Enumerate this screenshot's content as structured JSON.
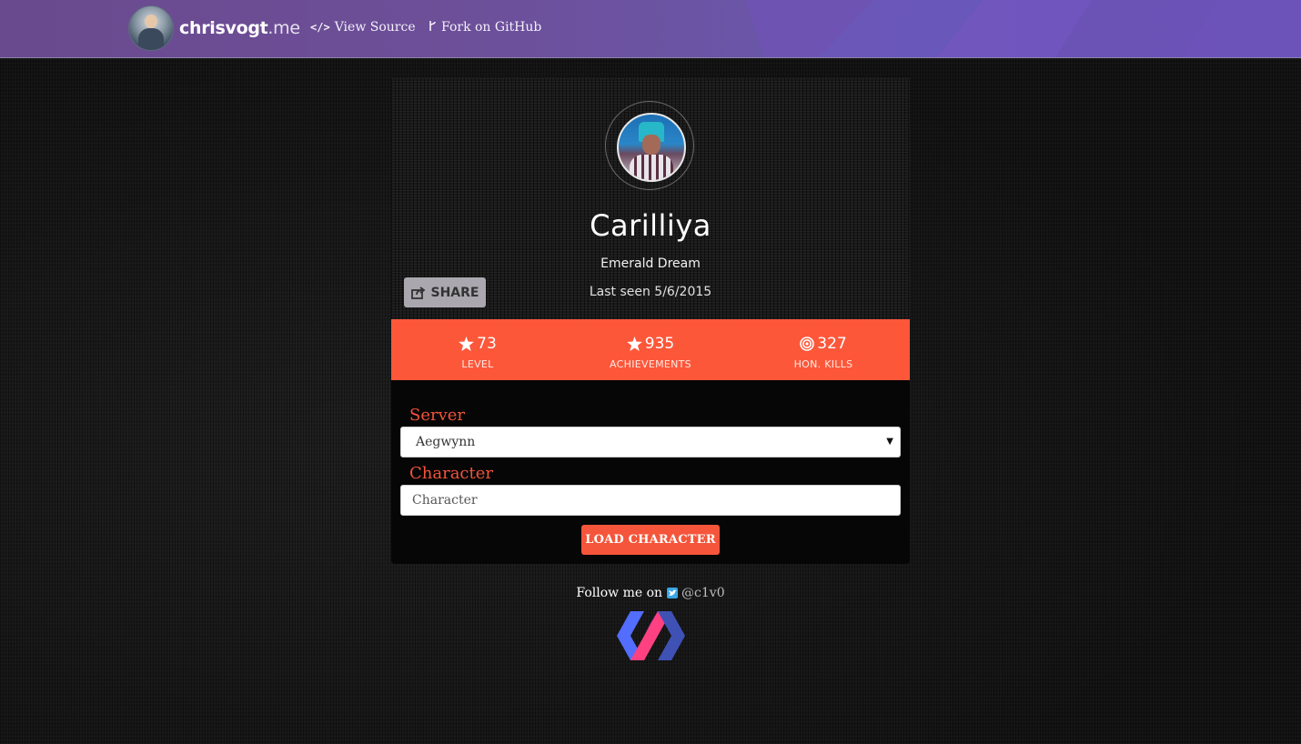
{
  "nav": {
    "brand_name": "chrisvogt",
    "brand_tld": ".me",
    "view_source_icon": "</>",
    "view_source_label": "View Source",
    "fork_icon": "branch-icon",
    "fork_label": "Fork on GitHub"
  },
  "profile": {
    "name": "Carilliya",
    "realm": "Emerald Dream",
    "last_seen": "Last seen 5/6/2015",
    "share_label": "SHARE"
  },
  "stats": [
    {
      "icon": "star-icon",
      "value": "73",
      "label": "LEVEL"
    },
    {
      "icon": "star-icon",
      "value": "935",
      "label": "ACHIEVEMENTS"
    },
    {
      "icon": "target-icon",
      "value": "327",
      "label": "HON. KILLS"
    }
  ],
  "form": {
    "server_label": "Server",
    "server_value": "Aegwynn",
    "character_label": "Character",
    "character_placeholder": "Character",
    "character_value": "",
    "load_button": "LOAD CHARACTER"
  },
  "footer": {
    "follow_text": "Follow me on",
    "twitter_icon": "twitter-icon",
    "handle": "@c1v0",
    "logo": "polymer-logo"
  },
  "colors": {
    "accent": "#fd573a",
    "label_red": "#f4533b",
    "nav_purple": "#6a4a8e",
    "share_gray": "#aaa8ae"
  }
}
